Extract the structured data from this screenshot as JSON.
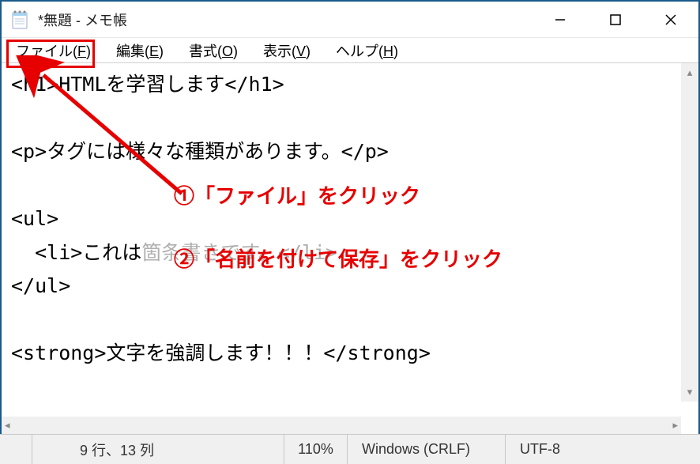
{
  "window": {
    "title": "*無題 - メモ帳"
  },
  "menu": {
    "file": {
      "label": "ファイル",
      "mnemonic": "F"
    },
    "edit": {
      "label": "編集",
      "mnemonic": "E"
    },
    "format": {
      "label": "書式",
      "mnemonic": "O"
    },
    "view": {
      "label": "表示",
      "mnemonic": "V"
    },
    "help": {
      "label": "ヘルプ",
      "mnemonic": "H"
    }
  },
  "editor": {
    "line1": "<h1>HTMLを学習します</h1>",
    "line2": "",
    "line3": "<p>タグには様々な種類があります。</p>",
    "line4": "",
    "line5": "<ul>",
    "line6a": "  <li>これは",
    "line6b": "箇条書きです。</li>",
    "line7": "</ul>",
    "line8": "",
    "line9": "<strong>文字を強調します！！！</strong>"
  },
  "annotations": {
    "a1": "①「ファイル」をクリック",
    "a2": "②「名前を付けて保存」をクリック"
  },
  "status": {
    "position": "9 行、13 列",
    "zoom": "110%",
    "eol": "Windows (CRLF)",
    "encoding": "UTF-8"
  }
}
